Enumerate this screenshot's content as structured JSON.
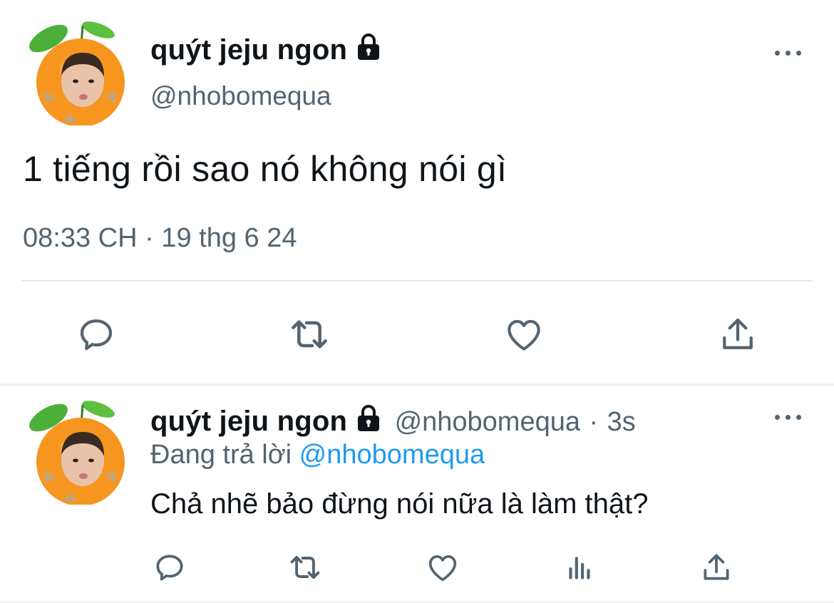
{
  "main_tweet": {
    "display_name": "quýt jeju ngon",
    "handle": "@nhobomequa",
    "text": "1 tiếng rồi sao nó không nói gì",
    "timestamp": "08:33 CH · 19 thg 6 24",
    "actions": [
      "reply-icon",
      "retweet-icon",
      "like-icon",
      "share-icon"
    ]
  },
  "reply_tweet": {
    "display_name": "quýt jeju ngon",
    "handle": "@nhobomequa",
    "time_sep": "·",
    "time_ago": "3s",
    "replying_prefix": "Đang trả lời",
    "replying_handle": "@nhobomequa",
    "text": "Chả nhẽ bảo đừng nói nữa là làm thật?",
    "actions": [
      "reply-icon",
      "retweet-icon",
      "like-icon",
      "analytics-icon",
      "share-icon"
    ]
  },
  "colors": {
    "text": "#0f1419",
    "muted": "#536471",
    "link": "#1d9bf0",
    "divider": "#e7e9ea",
    "avatar_orange": "#f7961f"
  }
}
